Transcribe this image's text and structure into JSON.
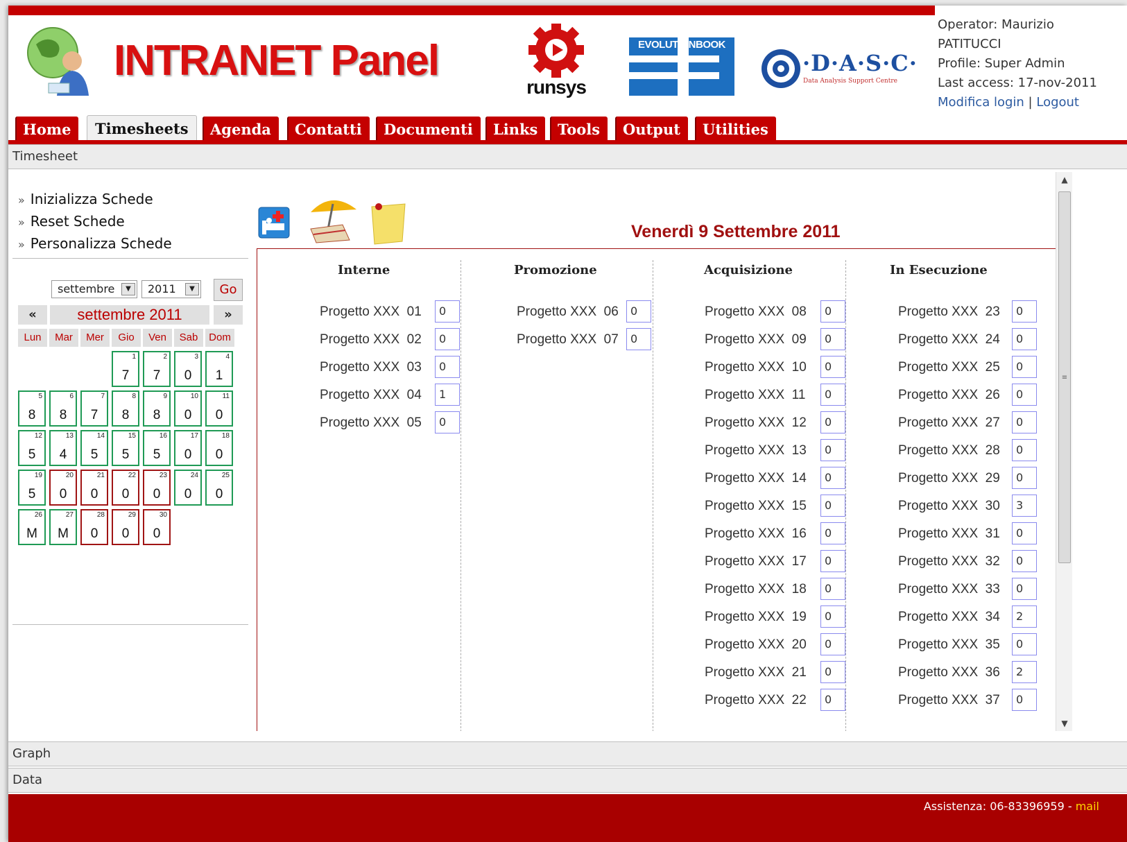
{
  "header": {
    "brand": "INTRANET Panel",
    "runsys": "runsys",
    "evolutionbook": "EVOLUTIONBOOK",
    "dasc": "·D·A·S·C·",
    "dasc_sub": "Data Analysis Support Centre",
    "operator_line1": "Operator: Maurizio",
    "operator_line2": "PATITUCCI",
    "profile": "Profile: Super Admin",
    "last_access": "Last access: 17-nov-2011",
    "modify_login": "Modifica login",
    "separator": "|",
    "logout": "Logout"
  },
  "tabs": [
    "Home",
    "Timesheets",
    "Agenda",
    "Contatti",
    "Documenti",
    "Links",
    "Tools",
    "Output",
    "Utilities"
  ],
  "active_tab": "Timesheets",
  "sections": {
    "timesheet": "Timesheet",
    "graph": "Graph",
    "data": "Data"
  },
  "sidebar": {
    "links": [
      "Inizializza Schede",
      "Reset Schede",
      "Personalizza Schede"
    ],
    "arrow": "»"
  },
  "calendar": {
    "month_select": "settembre",
    "year_select": "2011",
    "go": "Go",
    "prev": "«",
    "next": "»",
    "title": "settembre 2011",
    "dow": [
      "Lun",
      "Mar",
      "Mer",
      "Gio",
      "Ven",
      "Sab",
      "Dom"
    ],
    "days": [
      {
        "n": "1",
        "v": "7",
        "status": "green"
      },
      {
        "n": "2",
        "v": "7",
        "status": "green"
      },
      {
        "n": "3",
        "v": "0",
        "status": "green"
      },
      {
        "n": "4",
        "v": "1",
        "status": "green"
      },
      {
        "n": "5",
        "v": "8",
        "status": "green"
      },
      {
        "n": "6",
        "v": "8",
        "status": "green"
      },
      {
        "n": "7",
        "v": "7",
        "status": "green"
      },
      {
        "n": "8",
        "v": "8",
        "status": "green"
      },
      {
        "n": "9",
        "v": "8",
        "status": "green"
      },
      {
        "n": "10",
        "v": "0",
        "status": "green"
      },
      {
        "n": "11",
        "v": "0",
        "status": "green"
      },
      {
        "n": "12",
        "v": "5",
        "status": "green"
      },
      {
        "n": "13",
        "v": "4",
        "status": "green"
      },
      {
        "n": "14",
        "v": "5",
        "status": "green"
      },
      {
        "n": "15",
        "v": "5",
        "status": "green"
      },
      {
        "n": "16",
        "v": "5",
        "status": "green"
      },
      {
        "n": "17",
        "v": "0",
        "status": "green"
      },
      {
        "n": "18",
        "v": "0",
        "status": "green"
      },
      {
        "n": "19",
        "v": "5",
        "status": "green"
      },
      {
        "n": "20",
        "v": "0",
        "status": "red"
      },
      {
        "n": "21",
        "v": "0",
        "status": "red"
      },
      {
        "n": "22",
        "v": "0",
        "status": "red"
      },
      {
        "n": "23",
        "v": "0",
        "status": "red"
      },
      {
        "n": "24",
        "v": "0",
        "status": "green"
      },
      {
        "n": "25",
        "v": "0",
        "status": "green"
      },
      {
        "n": "26",
        "v": "M",
        "status": "green"
      },
      {
        "n": "27",
        "v": "M",
        "status": "green"
      },
      {
        "n": "28",
        "v": "0",
        "status": "red"
      },
      {
        "n": "29",
        "v": "0",
        "status": "red"
      },
      {
        "n": "30",
        "v": "0",
        "status": "red"
      }
    ]
  },
  "main": {
    "date_title": "Venerdì 9 Settembre 2011",
    "icons": [
      "sick-leave-icon",
      "vacation-icon",
      "note-icon"
    ],
    "columns": [
      {
        "title": "Interne",
        "projects": [
          {
            "name": "Progetto XXX  01",
            "value": "0"
          },
          {
            "name": "Progetto XXX  02",
            "value": "0"
          },
          {
            "name": "Progetto XXX  03",
            "value": "0"
          },
          {
            "name": "Progetto XXX  04",
            "value": "1"
          },
          {
            "name": "Progetto XXX  05",
            "value": "0"
          }
        ]
      },
      {
        "title": "Promozione",
        "projects": [
          {
            "name": "Progetto XXX  06",
            "value": "0"
          },
          {
            "name": "Progetto XXX  07",
            "value": "0"
          }
        ]
      },
      {
        "title": "Acquisizione",
        "projects": [
          {
            "name": "Progetto XXX  08",
            "value": "0"
          },
          {
            "name": "Progetto XXX  09",
            "value": "0"
          },
          {
            "name": "Progetto XXX  10",
            "value": "0"
          },
          {
            "name": "Progetto XXX  11",
            "value": "0"
          },
          {
            "name": "Progetto XXX  12",
            "value": "0"
          },
          {
            "name": "Progetto XXX  13",
            "value": "0"
          },
          {
            "name": "Progetto XXX  14",
            "value": "0"
          },
          {
            "name": "Progetto XXX  15",
            "value": "0"
          },
          {
            "name": "Progetto XXX  16",
            "value": "0"
          },
          {
            "name": "Progetto XXX  17",
            "value": "0"
          },
          {
            "name": "Progetto XXX  18",
            "value": "0"
          },
          {
            "name": "Progetto XXX  19",
            "value": "0"
          },
          {
            "name": "Progetto XXX  20",
            "value": "0"
          },
          {
            "name": "Progetto XXX  21",
            "value": "0"
          },
          {
            "name": "Progetto XXX  22",
            "value": "0"
          }
        ]
      },
      {
        "title": "In Esecuzione",
        "projects": [
          {
            "name": "Progetto XXX  23",
            "value": "0"
          },
          {
            "name": "Progetto XXX  24",
            "value": "0"
          },
          {
            "name": "Progetto XXX  25",
            "value": "0"
          },
          {
            "name": "Progetto XXX  26",
            "value": "0"
          },
          {
            "name": "Progetto XXX  27",
            "value": "0"
          },
          {
            "name": "Progetto XXX  28",
            "value": "0"
          },
          {
            "name": "Progetto XXX  29",
            "value": "0"
          },
          {
            "name": "Progetto XXX  30",
            "value": "3"
          },
          {
            "name": "Progetto XXX  31",
            "value": "0"
          },
          {
            "name": "Progetto XXX  32",
            "value": "0"
          },
          {
            "name": "Progetto XXX  33",
            "value": "0"
          },
          {
            "name": "Progetto XXX  34",
            "value": "2"
          },
          {
            "name": "Progetto XXX  35",
            "value": "0"
          },
          {
            "name": "Progetto XXX  36",
            "value": "2"
          },
          {
            "name": "Progetto XXX  37",
            "value": "0"
          }
        ]
      }
    ]
  },
  "footer": {
    "assistance": "Assistenza: 06-83396959 - ",
    "mail": "mail"
  },
  "colors": {
    "brand_red": "#c40000",
    "title_red": "#a01010",
    "ok_green": "#1f9a55",
    "missing_red": "#a01414"
  }
}
